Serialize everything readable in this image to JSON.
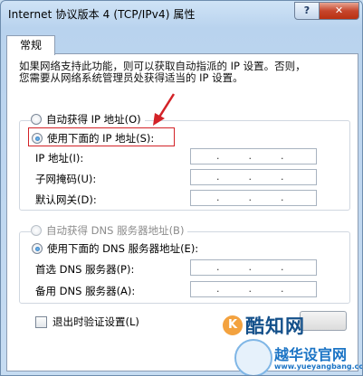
{
  "window": {
    "title": "Internet 协议版本 4 (TCP/IPv4) 属性",
    "help_label": "?",
    "close_label": "✕"
  },
  "tabs": [
    {
      "label": "常规"
    }
  ],
  "description": {
    "line1": "如果网络支持此功能，则可以获取自动指派的 IP 设置。否则，",
    "line2": "您需要从网络系统管理员处获得适当的 IP 设置。"
  },
  "ip_mode": {
    "auto_label": "自动获得 IP 地址(O)",
    "manual_label": "使用下面的 IP 地址(S):",
    "selected": "manual"
  },
  "ip_fields": [
    {
      "label": "IP 地址(I):",
      "value": ". . ."
    },
    {
      "label": "子网掩码(U):",
      "value": ". . ."
    },
    {
      "label": "默认网关(D):",
      "value": ". . ."
    }
  ],
  "dns_mode": {
    "auto_label": "自动获得 DNS 服务器地址(B)",
    "manual_label": "使用下面的 DNS 服务器地址(E):",
    "selected": "manual",
    "auto_disabled": true
  },
  "dns_fields": [
    {
      "label": "首选 DNS 服务器(P):",
      "value": ". . ."
    },
    {
      "label": "备用 DNS 服务器(A):",
      "value": ". . ."
    }
  ],
  "validate_on_exit": {
    "label": "退出时验证设置(L)",
    "checked": false
  },
  "watermarks": {
    "brand1": "酷知网",
    "brand2": "越华设官网",
    "url": "www.yueyangbang.com"
  },
  "colors": {
    "highlight_box": "#d32227",
    "arrow": "#d32227",
    "title_bar": "#c4daf1"
  }
}
